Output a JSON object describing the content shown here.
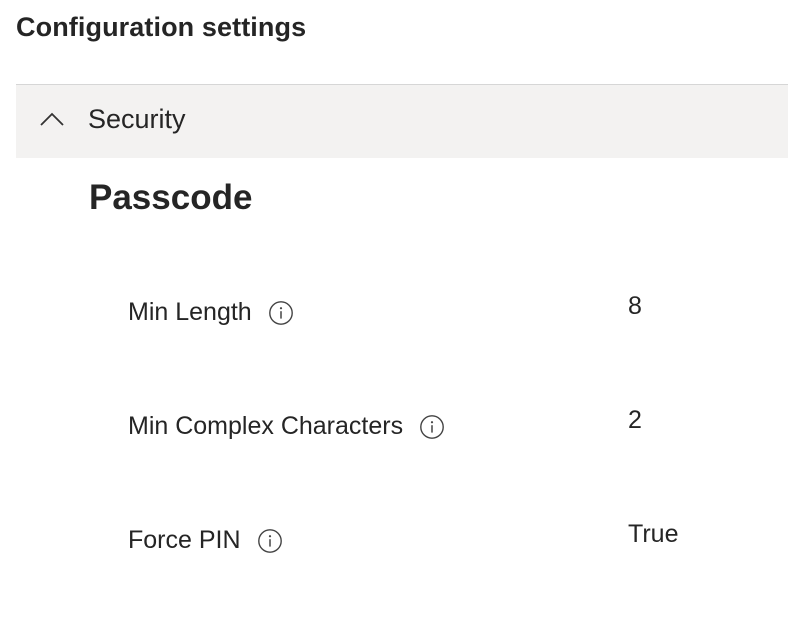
{
  "page": {
    "title": "Configuration settings"
  },
  "section": {
    "label": "Security",
    "expanded": true,
    "icon": "chevron-up-icon"
  },
  "subsection": {
    "title": "Passcode"
  },
  "settings": [
    {
      "label": "Min Length",
      "value": "8",
      "icon": "info-icon"
    },
    {
      "label": "Min Complex Characters",
      "value": "2",
      "icon": "info-icon"
    },
    {
      "label": "Force PIN",
      "value": "True",
      "icon": "info-icon"
    }
  ],
  "colors": {
    "section_header_bg": "#f3f2f1",
    "text": "#252525",
    "divider": "#d6d6d6"
  }
}
